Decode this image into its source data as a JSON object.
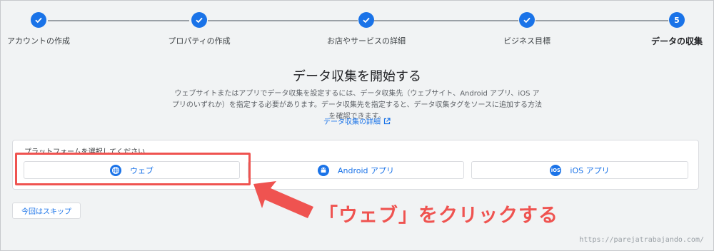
{
  "stepper": {
    "steps": [
      {
        "label": "アカウントの作成",
        "state": "done"
      },
      {
        "label": "プロパティの作成",
        "state": "done"
      },
      {
        "label": "お店やサービスの詳細",
        "state": "done"
      },
      {
        "label": "ビジネス目標",
        "state": "done"
      },
      {
        "label": "データの収集",
        "state": "current",
        "number": "5"
      }
    ]
  },
  "main": {
    "title": "データ収集を開始する",
    "description": "ウェブサイトまたはアプリでデータ収集を設定するには、データ収集先（ウェブサイト、Android アプリ、iOS アプリのいずれか）を指定する必要があります。データ収集先を指定すると、データ収集タグをソースに追加する方法を確認できます。",
    "detail_link": "データ収集の詳細"
  },
  "platform": {
    "label": "プラットフォームを選択してください",
    "options": [
      {
        "label": "ウェブ",
        "icon": "globe-icon"
      },
      {
        "label": "Android アプリ",
        "icon": "android-icon"
      },
      {
        "label": "iOS アプリ",
        "icon": "ios-icon",
        "icon_text": "iOS"
      }
    ]
  },
  "skip_label": "今回はスキップ",
  "annotation": {
    "callout": "「ウェブ」をクリックする",
    "color": "#ef5350"
  },
  "watermark": "https://parejatrabajando.com/",
  "colors": {
    "accent": "#1a73e8",
    "background": "#f1f3f4"
  }
}
